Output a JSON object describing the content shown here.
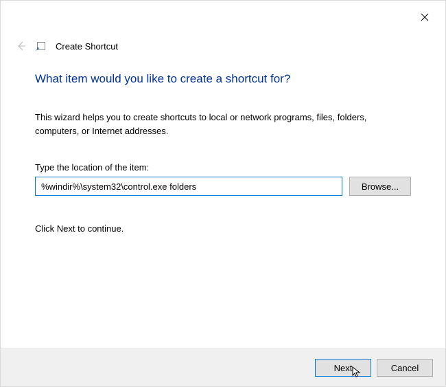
{
  "header": {
    "title": "Create Shortcut"
  },
  "main": {
    "heading": "What item would you like to create a shortcut for?",
    "description": "This wizard helps you to create shortcuts to local or network programs, files, folders, computers, or Internet addresses.",
    "field_label": "Type the location of the item:",
    "location_value": "%windir%\\system32\\control.exe folders",
    "browse_label": "Browse...",
    "continue_text": "Click Next to continue."
  },
  "footer": {
    "next_label": "Next",
    "cancel_label": "Cancel"
  }
}
